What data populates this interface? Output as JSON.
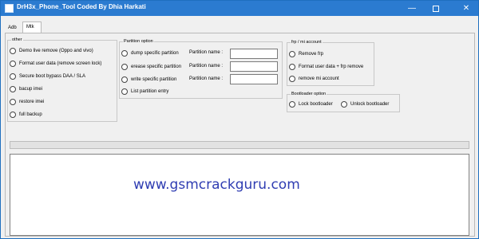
{
  "window": {
    "title": "DrH3x_Phone_Tool Coded By Dhia Harkati",
    "minimize_glyph": "—",
    "close_glyph": "✕"
  },
  "tabs": [
    {
      "label": "Adb",
      "selected": false
    },
    {
      "label": "Mtk",
      "selected": true
    }
  ],
  "other_group": {
    "title": "other",
    "options": [
      "Demo live remove (Oppo and vivo)",
      "Format user data (remove screen lock)",
      "Secure boot bypass DAA / SLA",
      "bacup imei",
      "restore imei",
      "full backup"
    ]
  },
  "partition_group": {
    "title": "Partition option",
    "options": [
      "dump specific partition",
      "erease specific partition",
      "write specific partition",
      "List partition entry"
    ],
    "field_label": "Partition name :",
    "fields": [
      "",
      "",
      ""
    ]
  },
  "frp_group": {
    "title": "frp / mi account",
    "options": [
      "Remove frp",
      "Format user data + frp remove",
      "remove mi account"
    ]
  },
  "bootloader_group": {
    "title": "Bootloader option",
    "options": [
      "Lock bootloader",
      "Unlock bootloader"
    ]
  },
  "progress": {
    "value": 0
  },
  "log": {
    "text": "www.gsmcrackguru.com"
  }
}
